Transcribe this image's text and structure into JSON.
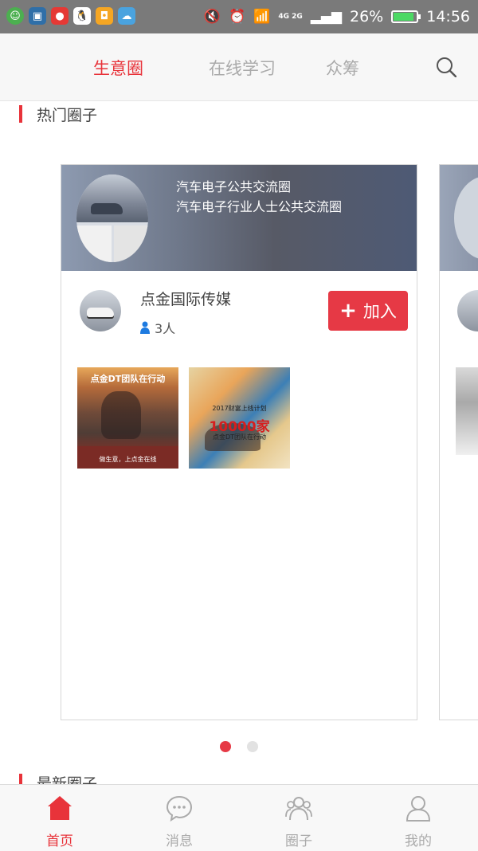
{
  "status_bar": {
    "signal_text": "4G 2G",
    "battery_percent": "26%",
    "time": "14:56",
    "battery_level": 0.9,
    "icons": [
      "message-app-icon",
      "screenshot-app-icon",
      "red-app-icon",
      "qq-icon",
      "orange-app-icon",
      "weather-app-icon",
      "mute-icon",
      "alarm-icon",
      "wifi-icon",
      "cell-signal-icon",
      "battery-icon"
    ]
  },
  "top_tabs": {
    "items": [
      {
        "label": "生意圈",
        "active": true
      },
      {
        "label": "在线学习",
        "active": false
      },
      {
        "label": "众筹",
        "active": false
      }
    ],
    "search_icon": "search-icon"
  },
  "hot_section": {
    "title": "热门圈子",
    "card": {
      "banner_title": "汽车电子公共交流圈",
      "banner_subtitle": "汽车电子行业人士公共交流圈",
      "member_name": "点金国际传媒",
      "member_count": "3人",
      "join_label": "加入",
      "thumbs": [
        {
          "cap1": "点金DT团队在行动",
          "cap2": "做生意，上点金在线"
        },
        {
          "cap1": "2017财富上线计划",
          "cap2": "10000家",
          "cap3": "点金DT团队在行动"
        }
      ]
    },
    "pager": {
      "count": 2,
      "active": 1
    }
  },
  "new_section": {
    "title": "最新圈子"
  },
  "bottom_nav": {
    "items": [
      {
        "label": "首页",
        "icon": "home-icon",
        "active": true
      },
      {
        "label": "消息",
        "icon": "chat-icon",
        "active": false
      },
      {
        "label": "圈子",
        "icon": "group-icon",
        "active": false
      },
      {
        "label": "我的",
        "icon": "profile-icon",
        "active": false
      }
    ]
  },
  "colors": {
    "accent": "#e8333a",
    "inactive": "#aaaaaa"
  }
}
